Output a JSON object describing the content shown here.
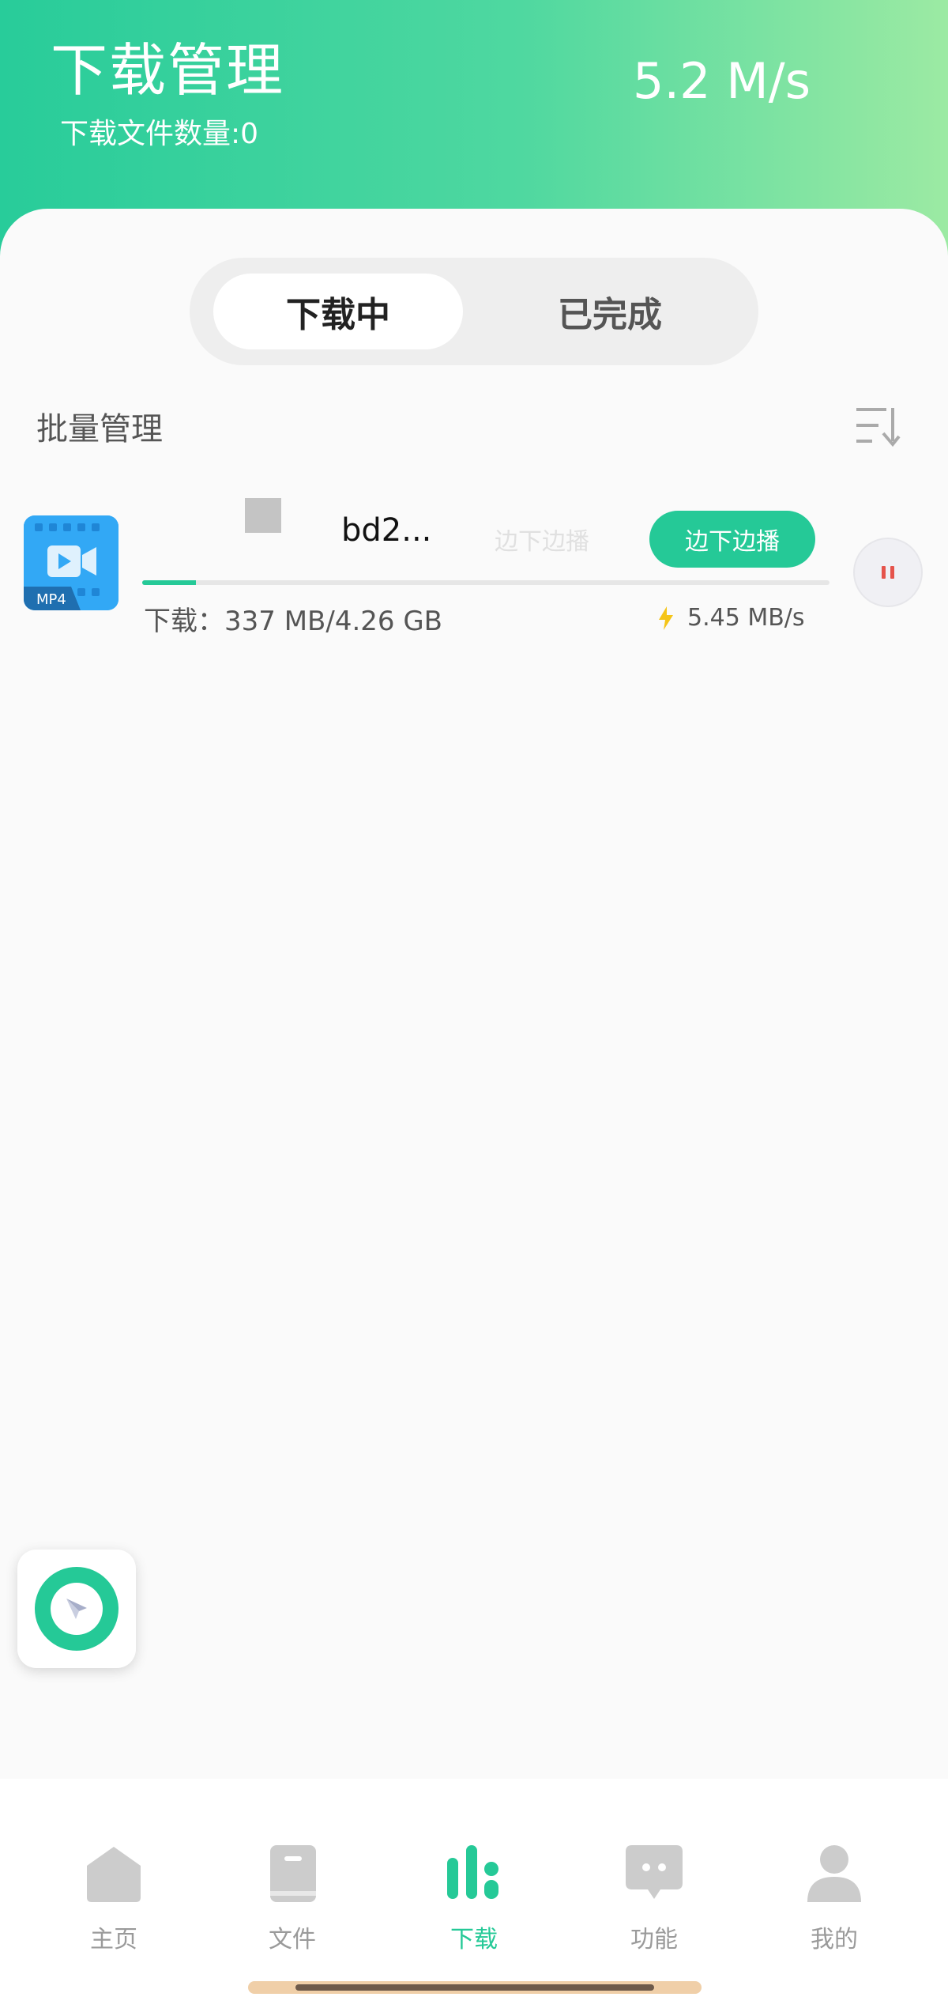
{
  "header": {
    "title": "下载管理",
    "file_count": "下载文件数量:0",
    "total_speed": "5.2 M/s"
  },
  "tabs": [
    {
      "label": "下载中",
      "active": true
    },
    {
      "label": "已完成",
      "active": false
    }
  ],
  "batch_manage": "批量管理",
  "download_item": {
    "file_type": "MP4",
    "name": "bd2...",
    "ghost_label": "边下边播",
    "play_label": "边下边播",
    "progress_fraction": 0.078,
    "downloaded": "下载：337 MB/4.26 GB",
    "speed": "5.45 MB/s"
  },
  "bottom_nav": [
    {
      "label": "主页",
      "icon": "home-icon",
      "active": false
    },
    {
      "label": "文件",
      "icon": "file-icon",
      "active": false
    },
    {
      "label": "下载",
      "icon": "download-icon",
      "active": true
    },
    {
      "label": "功能",
      "icon": "chat-icon",
      "active": false
    },
    {
      "label": "我的",
      "icon": "person-icon",
      "active": false
    }
  ],
  "colors": {
    "accent": "#25c997",
    "header_start": "#28cc9a",
    "header_end": "#9ceaa3",
    "pause_red": "#e5534b",
    "lightning": "#f5c518"
  }
}
